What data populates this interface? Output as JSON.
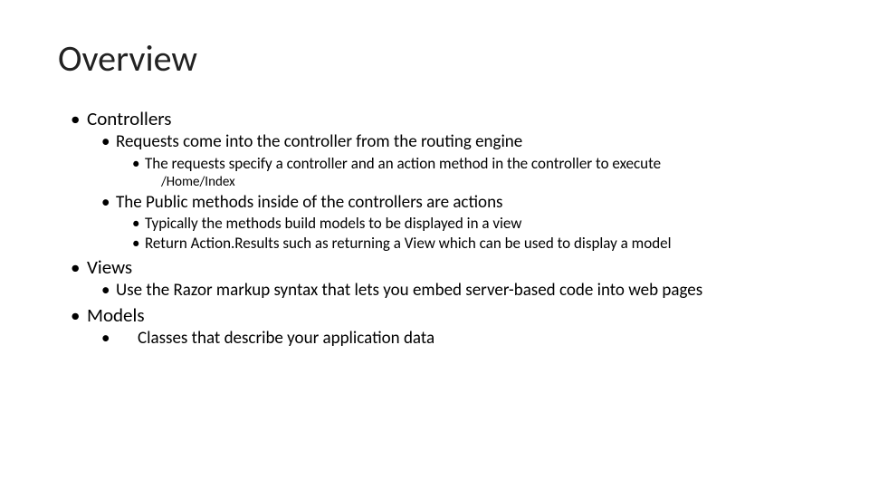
{
  "slide": {
    "title": "Overview",
    "controllers": {
      "heading": "Controllers",
      "sub1": "Requests come into the controller from the routing engine",
      "sub1_a": "The requests specify a controller and an action method in the controller to execute",
      "sub1_a_note": "/Home/Index",
      "sub2": "The Public methods inside of the controllers are actions",
      "sub2_a": "Typically the methods build models to be displayed in a view",
      "sub2_b": "Return Action.Results such as returning a View which can be used to display a model"
    },
    "views": {
      "heading": "Views",
      "sub1": "Use the Razor markup syntax that lets you embed server-based code into web pages"
    },
    "models": {
      "heading": "Models",
      "sub1": "Classes that describe your application data"
    }
  }
}
